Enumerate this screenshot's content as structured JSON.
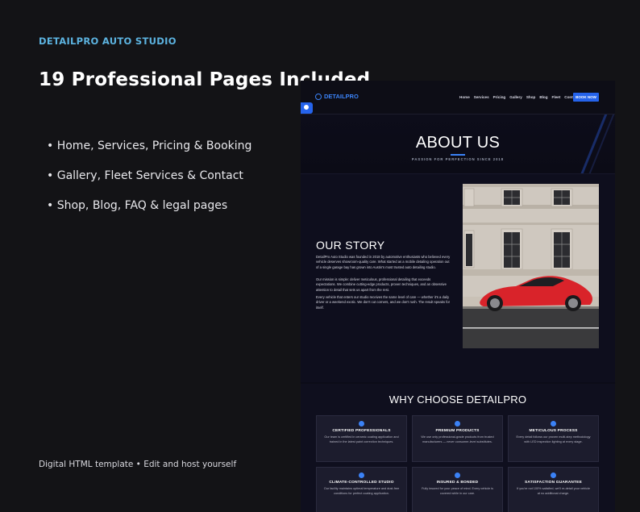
{
  "brand": "DETAILPRO AUTO STUDIO",
  "headline": "19 Professional Pages Included",
  "bullets": [
    "Home, Services, Pricing & Booking",
    "Gallery, Fleet Services & Contact",
    "Shop, Blog, FAQ & legal pages"
  ],
  "footer_note": "Digital HTML template • Edit and host yourself",
  "mockup": {
    "nav": {
      "logo": "DETAILPRO",
      "links": [
        "Home",
        "Services",
        "Pricing",
        "Gallery",
        "Shop",
        "Blog",
        "Fleet",
        "Contact"
      ],
      "cta": "BOOK NOW"
    },
    "hero": {
      "title": "ABOUT US",
      "subtitle": "PASSION FOR PERFECTION SINCE 2018"
    },
    "story": {
      "title": "OUR STORY",
      "p1": "DetailPro Auto Studio was founded in 2018 by automotive enthusiasts who believed every vehicle deserves showroom-quality care. What started as a mobile detailing operation out of a single garage bay has grown into Austin's most trusted auto detailing studio.",
      "p2": "Our mission is simple: deliver meticulous, professional detailing that exceeds expectations. We combine cutting-edge products, proven techniques, and an obsessive attention to detail that sets us apart from the rest.",
      "p3": "Every vehicle that enters our studio receives the same level of care — whether it's a daily driver or a weekend exotic. We don't cut corners, and we don't rush. The result speaks for itself."
    },
    "why": {
      "title": "WHY CHOOSE DETAILPRO",
      "cards": [
        {
          "icon": "certificate-icon",
          "title": "CERTIFIED PROFESSIONALS",
          "text": "Our team is certified in ceramic coating application and trained in the latest paint correction techniques."
        },
        {
          "icon": "flask-icon",
          "title": "PREMIUM PRODUCTS",
          "text": "We use only professional-grade products from trusted manufacturers — never consumer-level substitutes."
        },
        {
          "icon": "process-icon",
          "title": "METICULOUS PROCESS",
          "text": "Every detail follows our proven multi-step methodology with LED inspection lighting at every stage."
        },
        {
          "icon": "building-icon",
          "title": "CLIMATE-CONTROLLED STUDIO",
          "text": "Our facility maintains optimal temperature and dust-free conditions for perfect coating application."
        },
        {
          "icon": "shield-icon",
          "title": "INSURED & BONDED",
          "text": "Fully insured for your peace of mind. Every vehicle is covered while in our care."
        },
        {
          "icon": "star-icon",
          "title": "SATISFACTION GUARANTEE",
          "text": "If you're not 100% satisfied, we'll re-detail your vehicle at no additional charge."
        }
      ]
    },
    "colors": {
      "accent": "#2563eb",
      "brand_label": "#5cb3e0",
      "car": "#d9232a"
    }
  }
}
